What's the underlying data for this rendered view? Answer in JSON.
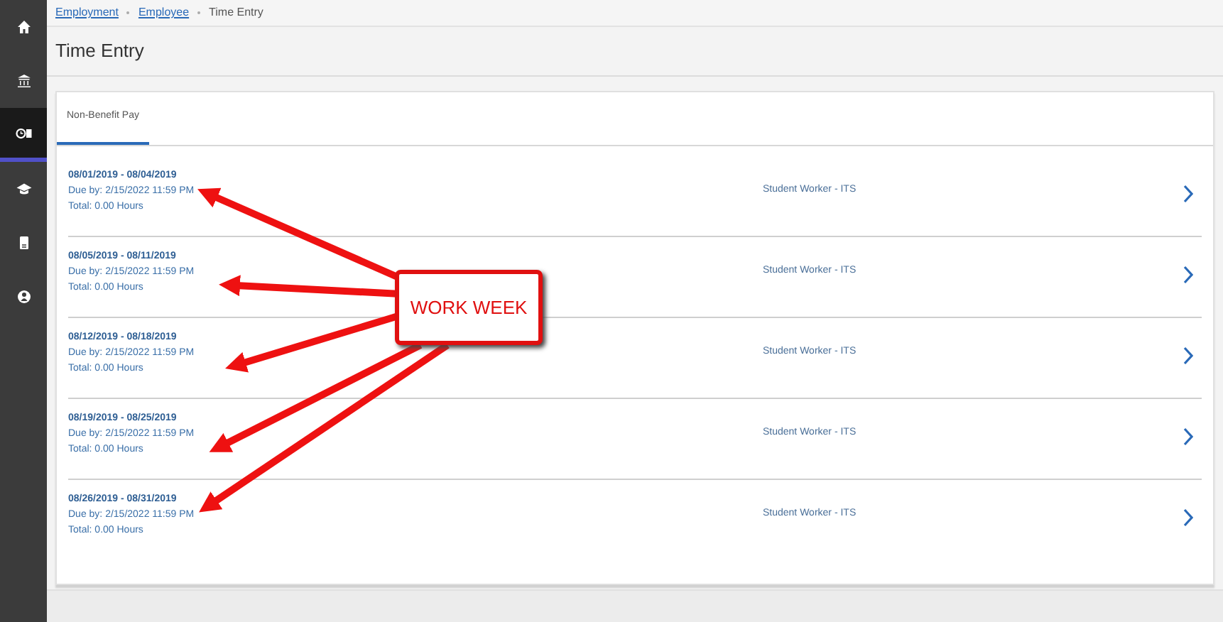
{
  "breadcrumb": [
    {
      "label": "Employment",
      "link": true
    },
    {
      "label": "Employee",
      "link": true
    },
    {
      "label": "Time Entry",
      "link": false
    }
  ],
  "title": "Time Entry",
  "sidebar": {
    "items": [
      {
        "kind": "home",
        "selected": false
      },
      {
        "kind": "bank",
        "selected": false
      },
      {
        "kind": "clock",
        "selected": true
      },
      {
        "kind": "cap",
        "selected": false
      },
      {
        "kind": "doc",
        "selected": false
      },
      {
        "kind": "person",
        "selected": false
      }
    ]
  },
  "tabs": [
    {
      "label": "Non-Benefit Pay",
      "selected": true
    }
  ],
  "rows": [
    {
      "period": "08/01/2019 - 08/04/2019",
      "due": "Due by: 2/15/2022 11:59 PM",
      "total": "Total: 0.00 Hours",
      "position": "Student Worker - ITS"
    },
    {
      "period": "08/05/2019 - 08/11/2019",
      "due": "Due by: 2/15/2022 11:59 PM",
      "total": "Total: 0.00 Hours",
      "position": "Student Worker - ITS"
    },
    {
      "period": "08/12/2019 - 08/18/2019",
      "due": "Due by: 2/15/2022 11:59 PM",
      "total": "Total: 0.00 Hours",
      "position": "Student Worker - ITS"
    },
    {
      "period": "08/19/2019 - 08/25/2019",
      "due": "Due by: 2/15/2022 11:59 PM",
      "total": "Total: 0.00 Hours",
      "position": "Student Worker - ITS"
    },
    {
      "period": "08/26/2019 - 08/31/2019",
      "due": "Due by: 2/15/2022 11:59 PM",
      "total": "Total: 0.00 Hours",
      "position": "Student Worker - ITS"
    }
  ],
  "annotation": {
    "label": "WORK WEEK"
  }
}
